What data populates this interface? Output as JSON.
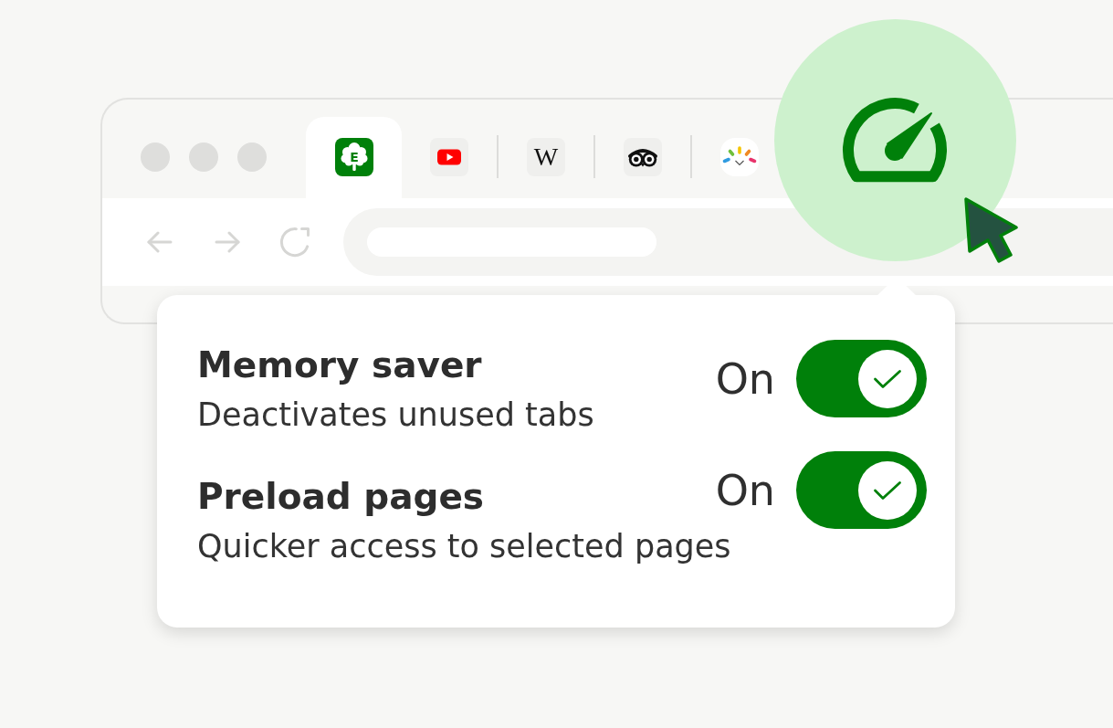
{
  "browser": {
    "tabs": [
      {
        "kind": "tree",
        "glyph": "E",
        "selected": true
      },
      {
        "kind": "play",
        "selected": false
      },
      {
        "kind": "letter",
        "glyph": "W",
        "selected": false
      },
      {
        "kind": "owl",
        "selected": false
      },
      {
        "kind": "rays",
        "selected": false
      }
    ]
  },
  "popup": {
    "settings": [
      {
        "title": "Memory saver",
        "description": "Deactivates unused tabs",
        "status": "On",
        "on": true
      },
      {
        "title": "Preload pages",
        "description": "Quicker access to selected pages",
        "status": "On",
        "on": true
      }
    ]
  }
}
